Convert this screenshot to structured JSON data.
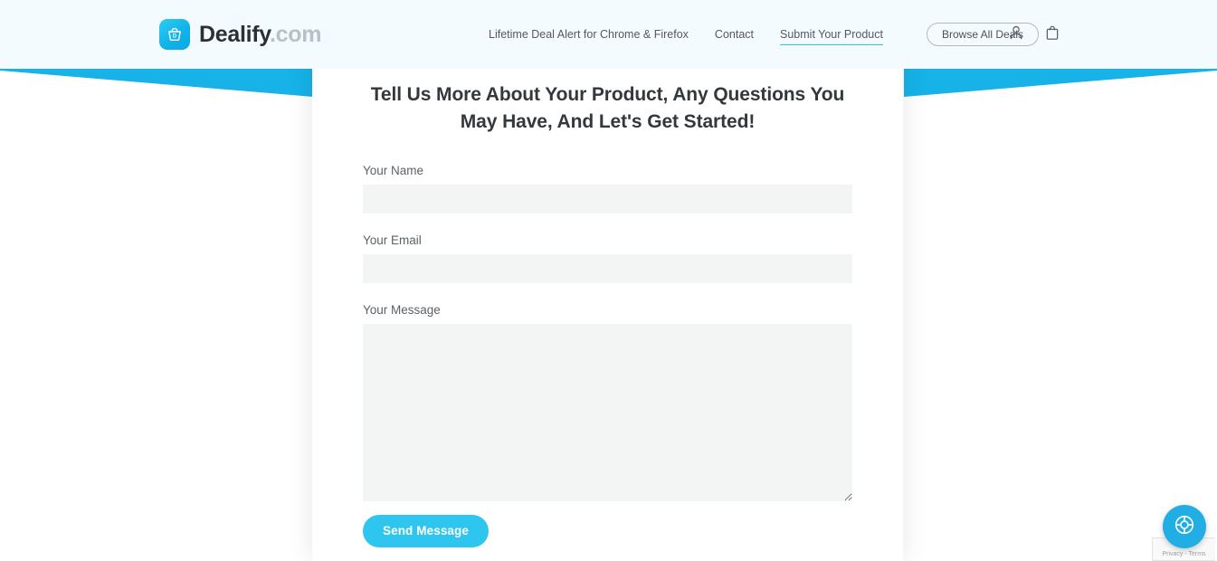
{
  "header": {
    "logo": {
      "icon": "shopping-basket-icon",
      "brand": "Dealify",
      "suffix": ".com"
    },
    "nav_links": [
      {
        "label": "Lifetime Deal Alert for Chrome & Firefox",
        "active": false
      },
      {
        "label": "Contact",
        "active": false
      },
      {
        "label": "Submit Your Product",
        "active": true
      }
    ],
    "browse_button": "Browse All Deals",
    "icons": [
      {
        "name": "account-icon",
        "glyph": "person"
      },
      {
        "name": "cart-icon",
        "glyph": "shopping-bag"
      }
    ],
    "background_color": "#f4fbfe"
  },
  "decoration": {
    "wedge_color": "#17b2e8"
  },
  "main": {
    "headline": "Tell Us More About Your Product, Any Questions You May Have, And Let's Get Started!",
    "form": {
      "name_field": {
        "label": "Your Name",
        "value": "",
        "placeholder": ""
      },
      "email_field": {
        "label": "Your Email",
        "value": "",
        "placeholder": ""
      },
      "message_field": {
        "label": "Your Message",
        "value": "",
        "placeholder": ""
      },
      "submit_label": "Send Message",
      "submit_color": "#2ec5ef",
      "input_background": "#f3f4f4"
    }
  },
  "widgets": {
    "support_fab": {
      "icon": "lifebuoy-icon",
      "color": "#21aee4"
    },
    "recaptcha": {
      "text": "Privacy - Terms"
    }
  }
}
